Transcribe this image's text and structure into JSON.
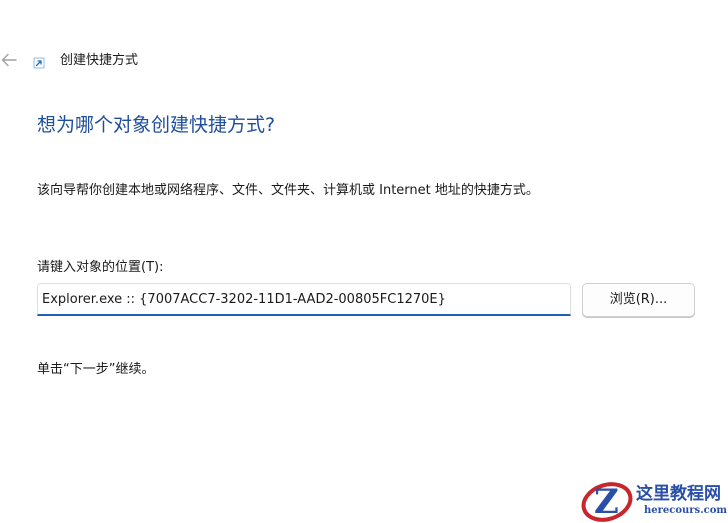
{
  "window": {
    "title": "创建快捷方式",
    "icons": {
      "back": "back-arrow-icon",
      "wizard": "shortcut-icon"
    }
  },
  "content": {
    "heading": "想为哪个对象创建快捷方式?",
    "description": "该向导帮你创建本地或网络程序、文件、文件夹、计算机或 Internet 地址的快捷方式。",
    "location_label": "请键入对象的位置(T):",
    "location_value": "Explorer.exe :: {7007ACC7-3202-11D1-AAD2-00805FC1270E}",
    "browse_label": "浏览(R)...",
    "hint": "单击“下一步”继续。"
  },
  "watermark": {
    "name": "这里教程网",
    "url": "herecours.com"
  },
  "colors": {
    "heading": "#1f4e9c",
    "input_focus": "#1f5fb5",
    "watermark": "#2a4fa8",
    "watermark_accent": "#c8252c"
  }
}
